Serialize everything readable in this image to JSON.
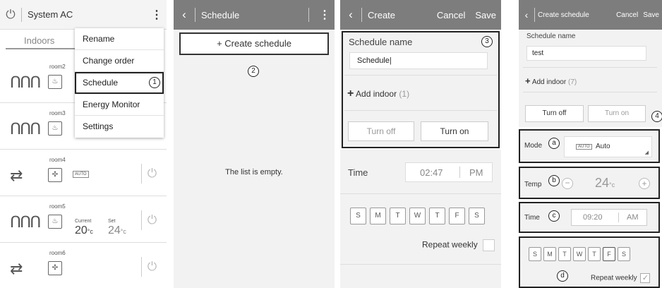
{
  "panel1": {
    "title": "System AC",
    "tab": "Indoors",
    "menu": [
      "Rename",
      "Change order",
      "Schedule",
      "Energy Monitor",
      "Settings"
    ],
    "callout": "1",
    "rooms": [
      {
        "name": "room2"
      },
      {
        "name": "room3"
      },
      {
        "name": "room4",
        "mode_badge": "AUTO"
      },
      {
        "name": "room5",
        "current_label": "Current",
        "current_value": "20",
        "set_label": "Set",
        "set_value": "24",
        "unit": "°c"
      },
      {
        "name": "room6"
      }
    ]
  },
  "panel2": {
    "title": "Schedule",
    "create_label": "+ Create schedule",
    "callout": "2",
    "empty_text": "The list is empty."
  },
  "panel3": {
    "title": "Create",
    "cancel": "Cancel",
    "save": "Save",
    "name_label": "Schedule name",
    "name_value": "Schedule",
    "callout": "3",
    "add_indoor": "Add indoor",
    "add_count": "(1)",
    "turn_off": "Turn off",
    "turn_on": "Turn on",
    "time_label": "Time",
    "time_value": "02:47",
    "ampm": "PM",
    "days": [
      "S",
      "M",
      "T",
      "W",
      "T",
      "F",
      "S"
    ],
    "repeat": "Repeat weekly"
  },
  "panel4": {
    "title": "Create schedule",
    "cancel": "Cancel",
    "save": "Save",
    "name_label": "Schedule name",
    "name_value": "test",
    "add_indoor": "Add indoor",
    "add_count": "(7)",
    "turn_off": "Turn off",
    "turn_on": "Turn on",
    "callout": "4",
    "mode_label": "Mode",
    "mode_callout": "a",
    "mode_badge": "AUTO",
    "mode_value": "Auto",
    "temp_label": "Temp",
    "temp_callout": "b",
    "temp_value": "24",
    "temp_unit": "°c",
    "time_label": "Time",
    "time_callout": "c",
    "time_value": "09:20",
    "ampm": "AM",
    "days": [
      "S",
      "M",
      "T",
      "W",
      "T",
      "F",
      "S"
    ],
    "days_callout": "d",
    "repeat": "Repeat weekly"
  }
}
